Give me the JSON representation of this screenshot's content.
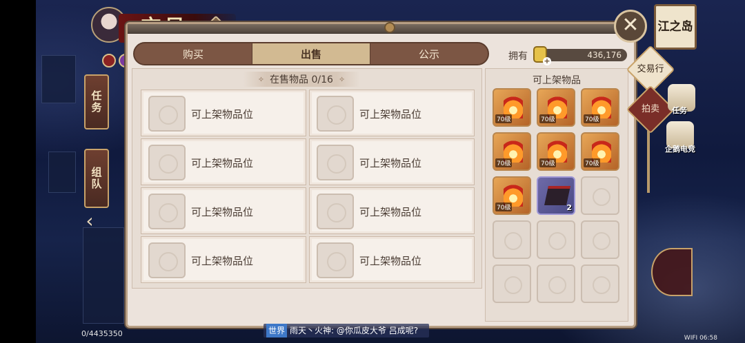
{
  "window": {
    "title": "交易"
  },
  "hud": {
    "help_glyph": "?",
    "task_tab": "任务",
    "team_tab": "组队",
    "back_glyph": "‹",
    "region_name": "江之岛",
    "close_glyph": "✕",
    "side_menu": {
      "trade": "交易行",
      "auction": "拍卖"
    },
    "right_icons": [
      {
        "icon": "scroll-icon",
        "label": "任务"
      },
      {
        "icon": "penguin-esports-icon",
        "label": "企鹅电竞"
      }
    ]
  },
  "tabs": [
    {
      "label": "购买",
      "active": false
    },
    {
      "label": "出售",
      "active": true
    },
    {
      "label": "公示",
      "active": false
    }
  ],
  "wallet": {
    "label": "拥有",
    "amount": "436,176",
    "icon": "coin-icon",
    "add_glyph": "+"
  },
  "on_sale": {
    "title": "在售物品 0/16",
    "ornament": "✧",
    "slots": [
      {
        "label": "可上架物品位"
      },
      {
        "label": "可上架物品位"
      },
      {
        "label": "可上架物品位"
      },
      {
        "label": "可上架物品位"
      },
      {
        "label": "可上架物品位"
      },
      {
        "label": "可上架物品位"
      },
      {
        "label": "可上架物品位"
      },
      {
        "label": "可上架物品位"
      }
    ]
  },
  "inventory": {
    "title": "可上架物品",
    "items": [
      {
        "kind": "fire",
        "level": "70级",
        "qty": ""
      },
      {
        "kind": "fire",
        "level": "70级",
        "qty": ""
      },
      {
        "kind": "fire",
        "level": "70级",
        "qty": ""
      },
      {
        "kind": "fire",
        "level": "70级",
        "qty": ""
      },
      {
        "kind": "fire",
        "level": "70级",
        "qty": ""
      },
      {
        "kind": "fire",
        "level": "70级",
        "qty": ""
      },
      {
        "kind": "fire",
        "level": "70级",
        "qty": ""
      },
      {
        "kind": "purple",
        "level": "",
        "qty": "2"
      },
      {
        "kind": "empty",
        "level": "",
        "qty": ""
      },
      {
        "kind": "empty",
        "level": "",
        "qty": ""
      },
      {
        "kind": "empty",
        "level": "",
        "qty": ""
      },
      {
        "kind": "empty",
        "level": "",
        "qty": ""
      },
      {
        "kind": "empty",
        "level": "",
        "qty": ""
      },
      {
        "kind": "empty",
        "level": "",
        "qty": ""
      },
      {
        "kind": "empty",
        "level": "",
        "qty": ""
      }
    ]
  },
  "chat": {
    "channel": "世界",
    "text": "雨天丶火神: @你瓜皮大爷 吕成呢?"
  },
  "exp_text": "0/4435350",
  "status": {
    "network": "WIFI",
    "time": "06:58"
  },
  "colors": {
    "panel_bg": "#ece3dc",
    "tab_active": "#d2ba92",
    "tab_bar": "#7c5644",
    "accent_red": "#7a2e28"
  }
}
